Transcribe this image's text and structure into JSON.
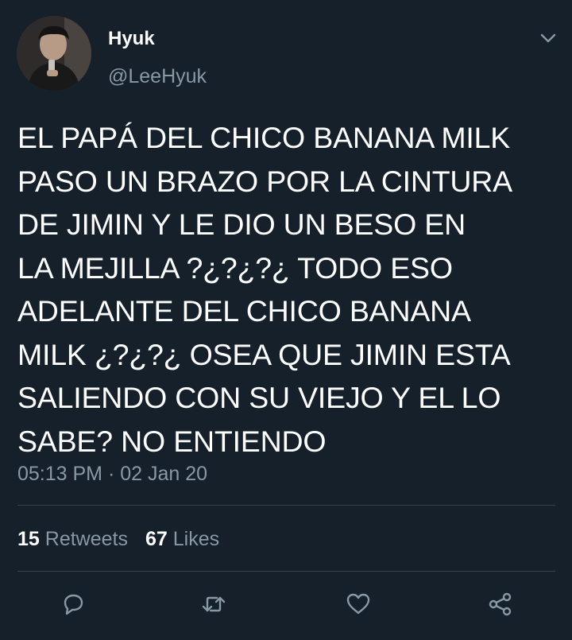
{
  "tweet": {
    "author": {
      "display_name": "Hyuk",
      "handle": "@LeeHyuk",
      "avatar_icon": "profile-photo"
    },
    "text": "EL PAPÁ DEL CHICO BANANA MILK\nPASO UN BRAZO POR LA CINTURA\nDE JIMIN Y LE DIO UN BESO EN\nLA MEJILLA ?¿?¿?¿ TODO ESO\nADELANTE DEL CHICO BANANA\nMILK ¿?¿?¿ OSEA QUE JIMIN ESTA\nSALIENDO CON SU VIEJO Y EL LO\nSABE? NO ENTIENDO",
    "timestamp": "05:13 PM · 02 Jan 20",
    "stats": {
      "retweets_count": "15",
      "retweets_label": "Retweets",
      "likes_count": "67",
      "likes_label": "Likes"
    }
  },
  "actions": {
    "reply_icon": "reply-icon",
    "retweet_icon": "retweet-icon",
    "like_icon": "heart-icon",
    "share_icon": "share-icon",
    "more_icon": "chevron-down-icon"
  },
  "colors": {
    "background": "#15202b",
    "text_primary": "#ffffff",
    "text_secondary": "#8899a6",
    "divider": "#38444d"
  }
}
